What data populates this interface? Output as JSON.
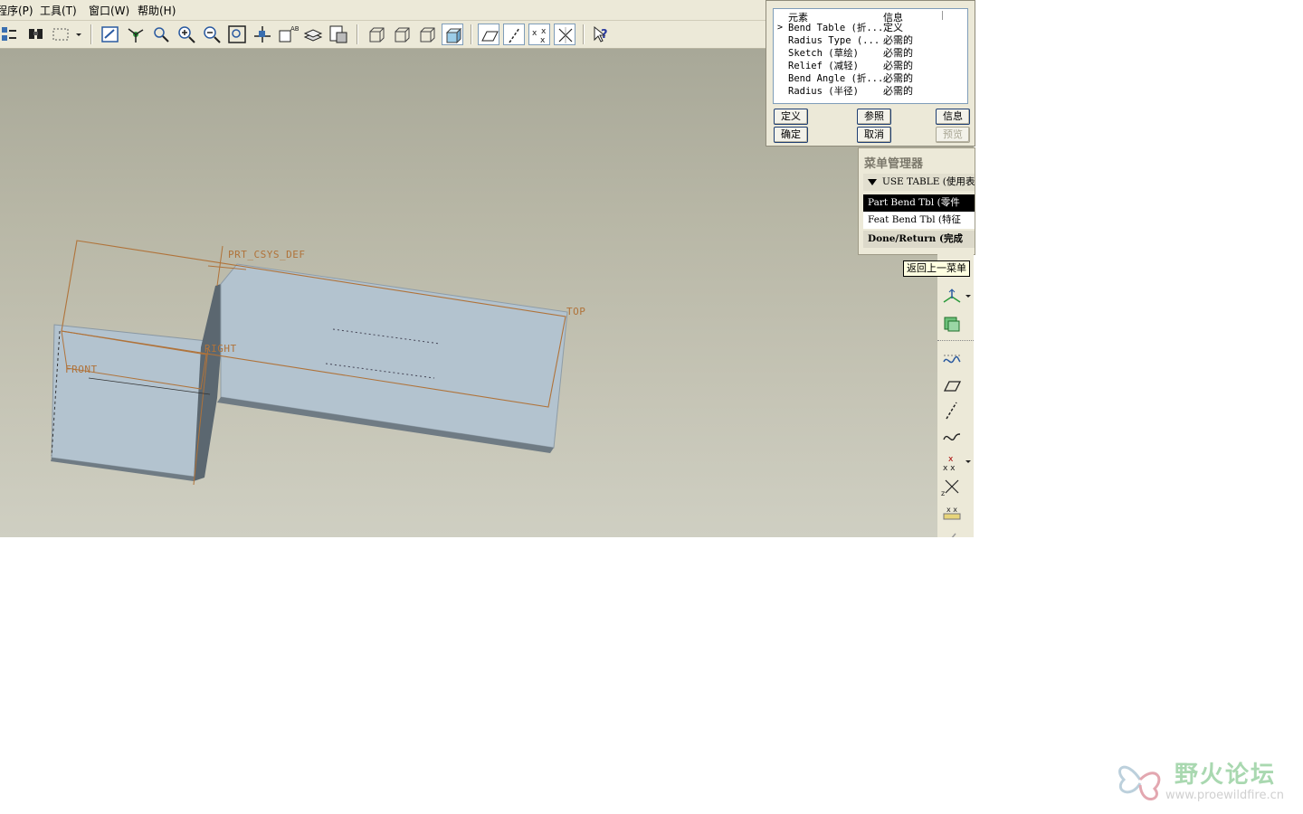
{
  "menubar": {
    "items": [
      "程序(P)",
      "工具(T)",
      "窗口(W)",
      "帮助(H)"
    ]
  },
  "toolbar": {
    "icons": [
      "regenerate-icon",
      "find-icon",
      "select-box-icon",
      "repaint-icon",
      "spin-center-icon",
      "orient-icon",
      "zoom-in-icon",
      "zoom-out-icon",
      "refit-icon",
      "reorient-icon",
      "saved-views-icon",
      "layers-icon",
      "view-manager-icon",
      "wireframe-icon",
      "hidden-line-icon",
      "no-hidden-icon",
      "shading-icon",
      "datum-planes-icon",
      "datum-axes-icon",
      "datum-points-icon",
      "csys-icon",
      "context-help-icon"
    ]
  },
  "viewport": {
    "labels": {
      "csys": "PRT_CSYS_DEF",
      "top": "TOP",
      "right": "RIGHT",
      "front": "FRONT"
    }
  },
  "dialog": {
    "header": {
      "element": "元素",
      "info": "信息"
    },
    "rows": [
      {
        "element": "Bend Table (折...",
        "info": "定义",
        "current": true
      },
      {
        "element": "Radius Type (...",
        "info": "必需的",
        "current": false
      },
      {
        "element": "Sketch (草绘)",
        "info": "必需的",
        "current": false
      },
      {
        "element": "Relief (减轻)",
        "info": "必需的",
        "current": false
      },
      {
        "element": "Bend Angle (折...",
        "info": "必需的",
        "current": false
      },
      {
        "element": "Radius (半径)",
        "info": "必需的",
        "current": false
      }
    ],
    "buttons": {
      "define": "定义",
      "refs": "参照",
      "info": "信息",
      "ok": "确定",
      "cancel": "取消",
      "preview": "预览"
    }
  },
  "menu_manager": {
    "title": "菜单管理器",
    "section": "USE TABLE (使用表",
    "items": [
      {
        "label": "Part Bend Tbl (零件",
        "selected": true
      },
      {
        "label": "Feat Bend Tbl (特征",
        "selected": false
      }
    ],
    "done": "Done/Return (完成"
  },
  "tooltip": "返回上一菜单",
  "right_toolbar": {
    "icons": [
      "datum-plane-offset-icon",
      "extrude-datum-icon",
      "curve-icon",
      "datum-plane-icon",
      "datum-axis-icon",
      "sketched-curve-icon",
      "datum-point-icon",
      "offset-point-icon",
      "field-point-icon",
      "edit-icon"
    ]
  },
  "watermark": {
    "text": "野火论坛",
    "url": "www.proewildfire.cn"
  },
  "colors": {
    "chrome": "#ece9d8",
    "part_fill": "#b3c3cf",
    "datum": "#b0733a",
    "selection": "#000000"
  }
}
